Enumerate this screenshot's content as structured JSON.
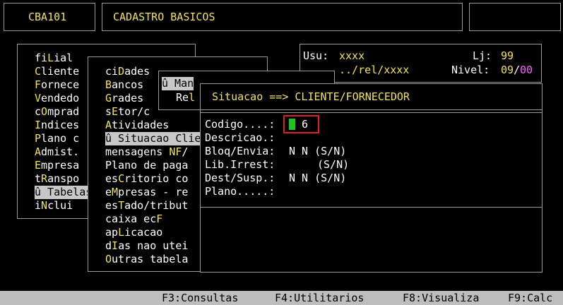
{
  "header": {
    "code": "CBA101",
    "title": "CADASTRO BASICOS"
  },
  "info": {
    "usu_label": "Usu:",
    "usu_value": "xxxx",
    "lj_label": "Lj:",
    "lj_value": "99",
    "path": "../rel/xxxx",
    "nivel_label": "Nivel:",
    "nivel_value": "09",
    "nivel_sep": "/",
    "nivel_extra": "00"
  },
  "menu1": [
    {
      "pre": "fi",
      "hot": "L",
      "post": "ial"
    },
    {
      "pre": "",
      "hot": "C",
      "post": "liente"
    },
    {
      "pre": "",
      "hot": "F",
      "post": "ornece"
    },
    {
      "pre": "",
      "hot": "V",
      "post": "endedo"
    },
    {
      "pre": "c",
      "hot": "O",
      "post": "mprad"
    },
    {
      "pre": "",
      "hot": "I",
      "post": "ndices"
    },
    {
      "pre": "",
      "hot": "P",
      "post": "lano c"
    },
    {
      "pre": "",
      "hot": "A",
      "post": "dmist."
    },
    {
      "pre": "",
      "hot": "E",
      "post": "mpresa"
    },
    {
      "pre": "t",
      "hot": "R",
      "post": "anspo"
    },
    {
      "pre": "û Tabelas",
      "hot": "",
      "post": ""
    },
    {
      "pre": "i",
      "hot": "N",
      "post": "clui"
    }
  ],
  "menu2": [
    {
      "pre": "ci",
      "hot": "D",
      "post": "ades"
    },
    {
      "pre": "",
      "hot": "B",
      "post": "ancos"
    },
    {
      "pre": "",
      "hot": "G",
      "post": "rades"
    },
    {
      "pre": "s",
      "hot": "E",
      "post": "tor/c"
    },
    {
      "pre": "",
      "hot": "A",
      "post": "tividades"
    },
    {
      "pre": "û Situacao Clie",
      "hot": "",
      "post": ""
    },
    {
      "pre": "mensagens ",
      "hot": "NF",
      "post": "/"
    },
    {
      "pre": "Plano de paga",
      "hot": "",
      "post": ""
    },
    {
      "pre": "es",
      "hot": "C",
      "post": "ritorio co"
    },
    {
      "pre": "e",
      "hot": "M",
      "post": "presas - re"
    },
    {
      "pre": "es",
      "hot": "T",
      "post": "ado/tribut"
    },
    {
      "pre": "caixa ec",
      "hot": "F",
      "post": ""
    },
    {
      "pre": "ap",
      "hot": "L",
      "post": "icacao"
    },
    {
      "pre": "d",
      "hot": "I",
      "post": "as nao utei"
    },
    {
      "pre": "",
      "hot": "O",
      "post": "utras tabela"
    }
  ],
  "menu3": {
    "item1": "û Man",
    "item2_pre": "Re",
    "item2_hot": "l"
  },
  "dialog": {
    "title": "Situacao ==> CLIENTE/FORNECEDOR",
    "codigo_label": "Codigo....:",
    "codigo_value": "6",
    "descricao_label": "Descricao.:",
    "bloq_label": "Bloq/Envia:",
    "bloq_value": "N N (S/N)",
    "lib_label": "Lib.Irrest:",
    "lib_value": "(S/N)",
    "dest_label": "Dest/Susp.:",
    "dest_value": "N N (S/N)",
    "plano_label": "Plano.....:"
  },
  "statusbar": {
    "f3": "F3:Consultas",
    "f4": "F4:Utilitarios",
    "f8": "F8:Visualiza",
    "f9": "F9:Calc"
  },
  "colors": {
    "hotkey": "#f3e35a",
    "text": "#ffffff",
    "accent": "#ff60ff",
    "highlight_bg": "#c8c8c8",
    "cursor": "#19c819",
    "focus_border": "#e02020"
  }
}
